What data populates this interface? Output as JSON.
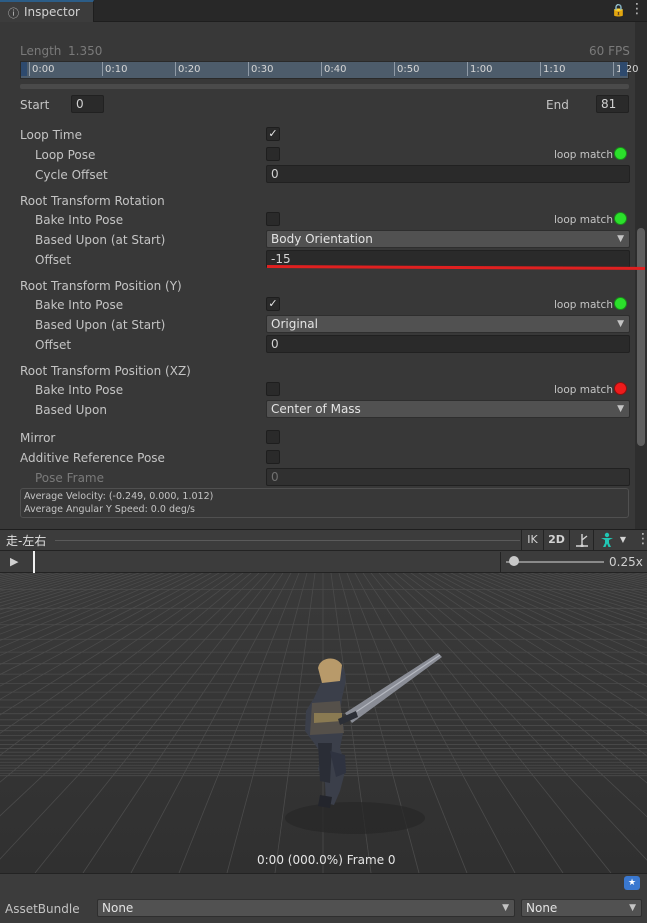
{
  "tab": {
    "icon": "info-icon",
    "title": "Inspector"
  },
  "clip": {
    "length_label": "Length",
    "length_value": "1.350",
    "fps": "60 FPS",
    "time_labels": [
      "0:00",
      "0:10",
      "0:20",
      "0:30",
      "0:40",
      "0:50",
      "1:00",
      "1:10",
      "1:20"
    ],
    "start_label": "Start",
    "start_value": "0",
    "end_label": "End",
    "end_value": "81"
  },
  "loop_time": {
    "label": "Loop Time",
    "checked": true,
    "loop_pose": {
      "label": "Loop Pose",
      "checked": false,
      "match": "loop match",
      "status": "green"
    },
    "cycle_offset": {
      "label": "Cycle Offset",
      "value": "0"
    }
  },
  "root_rotation": {
    "title": "Root Transform Rotation",
    "bake": {
      "label": "Bake Into Pose",
      "checked": false,
      "match": "loop match",
      "status": "green"
    },
    "based_upon": {
      "label": "Based Upon (at Start)",
      "value": "Body Orientation"
    },
    "offset": {
      "label": "Offset",
      "value": "-15"
    }
  },
  "root_position_y": {
    "title": "Root Transform Position (Y)",
    "bake": {
      "label": "Bake Into Pose",
      "checked": true,
      "match": "loop match",
      "status": "green"
    },
    "based_upon": {
      "label": "Based Upon (at Start)",
      "value": "Original"
    },
    "offset": {
      "label": "Offset",
      "value": "0"
    }
  },
  "root_position_xz": {
    "title": "Root Transform Position (XZ)",
    "bake": {
      "label": "Bake Into Pose",
      "checked": false,
      "match": "loop match",
      "status": "red"
    },
    "based_upon": {
      "label": "Based Upon",
      "value": "Center of Mass"
    }
  },
  "mirror": {
    "label": "Mirror",
    "checked": false
  },
  "additive": {
    "label": "Additive Reference Pose",
    "checked": false
  },
  "pose_frame": {
    "label": "Pose Frame",
    "value": "0"
  },
  "info": {
    "velocity": "Average Velocity: (-0.249, 0.000, 1.012)",
    "angular": "Average Angular Y Speed: 0.0 deg/s"
  },
  "preview": {
    "title": "走-左右",
    "ik": "IK",
    "two_d": "2D",
    "speed": "0.25x",
    "frame": "0:00 (000.0%) Frame 0"
  },
  "asset_bundle": {
    "label": "AssetBundle",
    "name": "None",
    "variant": "None"
  },
  "colors": {
    "match_green": "#2be02b",
    "match_red": "#ee1b1b",
    "annotation_red": "#e02020",
    "timeline_blue": "#4d5c6b"
  }
}
